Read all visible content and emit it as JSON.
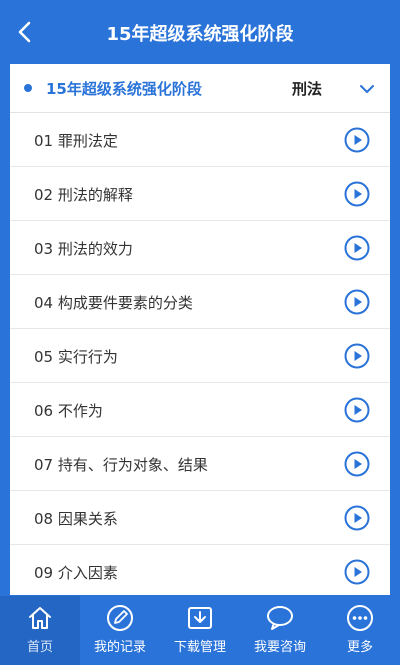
{
  "header": {
    "title": "15年超级系统强化阶段",
    "back_icon": "chevron-left-icon"
  },
  "section": {
    "title": "15年超级系统强化阶段",
    "subject": "刑法",
    "expand_icon": "chevron-down-icon"
  },
  "lessons": [
    {
      "label": "01 罪刑法定"
    },
    {
      "label": "02 刑法的解释"
    },
    {
      "label": "03 刑法的效力"
    },
    {
      "label": "04 构成要件要素的分类"
    },
    {
      "label": "05 实行行为"
    },
    {
      "label": "06 不作为"
    },
    {
      "label": "07 持有、行为对象、结果"
    },
    {
      "label": "08 因果关系"
    },
    {
      "label": "09 介入因素"
    }
  ],
  "tabbar": {
    "active_index": 0,
    "items": [
      {
        "label": "首页",
        "icon": "home-icon"
      },
      {
        "label": "我的记录",
        "icon": "pencil-icon"
      },
      {
        "label": "下载管理",
        "icon": "download-icon"
      },
      {
        "label": "我要咨询",
        "icon": "chat-bubble-icon"
      },
      {
        "label": "更多",
        "icon": "more-icon"
      }
    ]
  },
  "colors": {
    "brand": "#2a73d9",
    "active_tab": "#2466c4",
    "text": "#333333"
  }
}
